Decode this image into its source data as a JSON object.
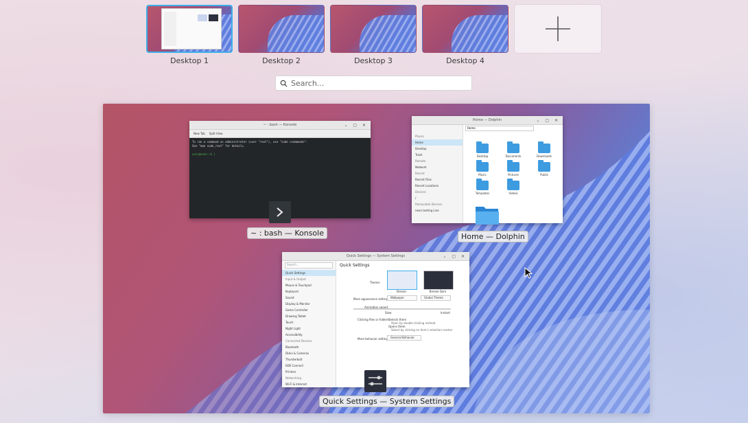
{
  "desktops": [
    {
      "label": "Desktop 1",
      "active": true
    },
    {
      "label": "Desktop 2",
      "active": false
    },
    {
      "label": "Desktop 3",
      "active": false
    },
    {
      "label": "Desktop 4",
      "active": false
    }
  ],
  "add_desktop": {
    "icon": "plus-icon",
    "symbol": "+"
  },
  "search": {
    "placeholder": "Search...",
    "icon": "search-icon"
  },
  "windows": {
    "konsole": {
      "caption": "~ : bash — Konsole",
      "title": "~ : bash — Konsole",
      "toolbar": [
        "New Tab",
        "Split View"
      ],
      "lines": [
        "To run a command as administrator (user \"root\"), use \"sudo <command>\".",
        "See \"man sudo_root\" for details.",
        "",
        "user@neon:~$ |"
      ],
      "icon": "terminal-icon"
    },
    "dolphin": {
      "caption": "Home — Dolphin",
      "title": "Home — Dolphin",
      "path": "Home",
      "sidebar_sections": [
        {
          "header": "Places",
          "items": [
            "Home",
            "Desktop",
            "Trash"
          ]
        },
        {
          "header": "Remote",
          "items": [
            "Network"
          ]
        },
        {
          "header": "Recent",
          "items": [
            "Recent Files",
            "Recent Locations"
          ]
        },
        {
          "header": "Devices",
          "items": [
            "/"
          ]
        },
        {
          "header": "Removable Devices",
          "items": [
            "neon testing Live"
          ]
        }
      ],
      "folders": [
        "Desktop",
        "Documents",
        "Downloads",
        "Music",
        "Pictures",
        "Public",
        "Templates",
        "Videos"
      ],
      "icon": "folder-icon"
    },
    "settings": {
      "caption": "Quick Settings — System Settings",
      "title": "Quick Settings — System Settings",
      "page_title": "Quick Settings",
      "search_placeholder": "Search...",
      "sidebar": [
        {
          "header": "",
          "items": [
            "Quick Settings"
          ]
        },
        {
          "header": "Input & Output",
          "items": [
            "Mouse & Touchpad",
            "Keyboard",
            "Sound",
            "Display & Monitor",
            "Game Controller",
            "Drawing Tablet",
            "Touch",
            "Night Light",
            "Accessibility"
          ]
        },
        {
          "header": "Connected Devices",
          "items": [
            "Bluetooth",
            "Disks & Cameras",
            "Thunderbolt",
            "KDE Connect",
            "Printers"
          ]
        },
        {
          "header": "Networking",
          "items": [
            "Wi-Fi & Internet"
          ]
        }
      ],
      "theme_label": "Theme:",
      "themes": [
        "Breeze",
        "Breeze Dark"
      ],
      "wallpaper_label": "More appearance settings:",
      "wallpaper_buttons": [
        "Wallpaper",
        "Global Theme"
      ],
      "animation_label": "Animation speed:",
      "animation_slow": "Slow",
      "animation_instant": "Instant",
      "click_label": "Clicking files or folders:",
      "click_options": [
        "Selects them",
        "Open by double-clicking instead",
        "Opens them",
        "Select by clicking on item's selection marker"
      ],
      "more_label": "More behavior settings:",
      "more_button": "General Behavior",
      "icon": "settings-sliders-icon"
    }
  },
  "colors": {
    "accent": "#3daee9",
    "folder": "#3d9be0"
  }
}
